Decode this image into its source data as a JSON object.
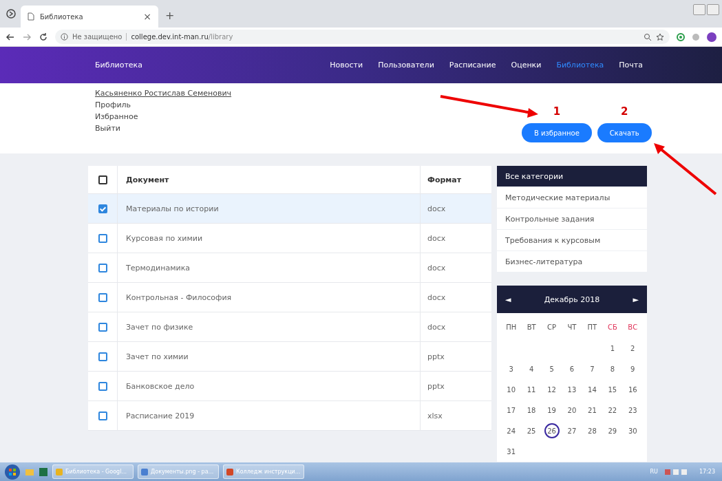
{
  "browser": {
    "tab_title": "Библиотека",
    "close": "×",
    "new_tab": "+",
    "security": "Не защищено",
    "url_host": "college.dev.int-man.ru",
    "url_path": "/library"
  },
  "navbar": {
    "brand": "Библиотека",
    "items": [
      {
        "label": "Новости",
        "selected": false
      },
      {
        "label": "Пользователи",
        "selected": false
      },
      {
        "label": "Расписание",
        "selected": false
      },
      {
        "label": "Оценки",
        "selected": false
      },
      {
        "label": "Библиотека",
        "selected": true
      },
      {
        "label": "Почта",
        "selected": false
      }
    ]
  },
  "user_menu": {
    "name": "Касьяненко Ростислав Семенович",
    "links": [
      "Профиль",
      "Избранное",
      "Выйти"
    ]
  },
  "actions": [
    {
      "label": "В избранное",
      "annotation": "1"
    },
    {
      "label": "Скачать",
      "annotation": "2"
    }
  ],
  "table": {
    "header_checked": false,
    "columns": [
      "Документ",
      "Формат"
    ],
    "rows": [
      {
        "checked": true,
        "document": "Материалы по истории",
        "format": "docx"
      },
      {
        "checked": false,
        "document": "Курсовая по химии",
        "format": "docx"
      },
      {
        "checked": false,
        "document": "Термодинамика",
        "format": "docx"
      },
      {
        "checked": false,
        "document": "Контрольная - Философия",
        "format": "docx"
      },
      {
        "checked": false,
        "document": "Зачет по физике",
        "format": "docx"
      },
      {
        "checked": false,
        "document": "Зачет по химии",
        "format": "pptx"
      },
      {
        "checked": false,
        "document": "Банковское дело",
        "format": "pptx"
      },
      {
        "checked": false,
        "document": "Расписание 2019",
        "format": "xlsx"
      }
    ]
  },
  "categories": [
    {
      "label": "Все категории",
      "selected": true
    },
    {
      "label": "Методические материалы",
      "selected": false
    },
    {
      "label": "Контрольные задания",
      "selected": false
    },
    {
      "label": "Требования к курсовым",
      "selected": false
    },
    {
      "label": "Бизнес-литература",
      "selected": false
    }
  ],
  "calendar": {
    "prev": "◄",
    "month": "Декабрь 2018",
    "next": "►",
    "weekdays": [
      {
        "label": "ПН",
        "weekend": false
      },
      {
        "label": "ВТ",
        "weekend": false
      },
      {
        "label": "СР",
        "weekend": false
      },
      {
        "label": "ЧТ",
        "weekend": false
      },
      {
        "label": "ПТ",
        "weekend": false
      },
      {
        "label": "СБ",
        "weekend": true
      },
      {
        "label": "ВС",
        "weekend": true
      }
    ],
    "weeks": [
      {
        "kind": "right",
        "days": [
          {
            "day": "1",
            "selected": false
          },
          {
            "day": "2",
            "selected": false
          }
        ]
      },
      {
        "kind": "left",
        "days": [
          {
            "day": "3",
            "selected": false
          },
          {
            "day": "4",
            "selected": false
          },
          {
            "day": "5",
            "selected": false
          },
          {
            "day": "6",
            "selected": false
          },
          {
            "day": "7",
            "selected": false
          },
          {
            "day": "8",
            "selected": false
          },
          {
            "day": "9",
            "selected": false
          }
        ]
      },
      {
        "kind": "left",
        "days": [
          {
            "day": "10",
            "selected": false
          },
          {
            "day": "11",
            "selected": false
          },
          {
            "day": "12",
            "selected": false
          },
          {
            "day": "13",
            "selected": false
          },
          {
            "day": "14",
            "selected": false
          },
          {
            "day": "15",
            "selected": false
          },
          {
            "day": "16",
            "selected": false
          }
        ]
      },
      {
        "kind": "left",
        "days": [
          {
            "day": "17",
            "selected": false
          },
          {
            "day": "18",
            "selected": false
          },
          {
            "day": "19",
            "selected": false
          },
          {
            "day": "20",
            "selected": false
          },
          {
            "day": "21",
            "selected": false
          },
          {
            "day": "22",
            "selected": false
          },
          {
            "day": "23",
            "selected": false
          }
        ]
      },
      {
        "kind": "left",
        "days": [
          {
            "day": "24",
            "selected": false
          },
          {
            "day": "25",
            "selected": false
          },
          {
            "day": "26",
            "selected": true
          },
          {
            "day": "27",
            "selected": false
          },
          {
            "day": "28",
            "selected": false
          },
          {
            "day": "29",
            "selected": false
          },
          {
            "day": "30",
            "selected": false
          }
        ]
      },
      {
        "kind": "left",
        "days": [
          {
            "day": "31",
            "selected": false
          }
        ]
      }
    ]
  },
  "taskbar": {
    "windows": [
      {
        "label": "Библиотека - Googl...",
        "kind": "browser"
      },
      {
        "label": "Документы.png - pa...",
        "kind": "paint"
      },
      {
        "label": "Колледж инструкци...",
        "kind": "slides"
      }
    ],
    "language": "RU",
    "time": "17:23"
  }
}
